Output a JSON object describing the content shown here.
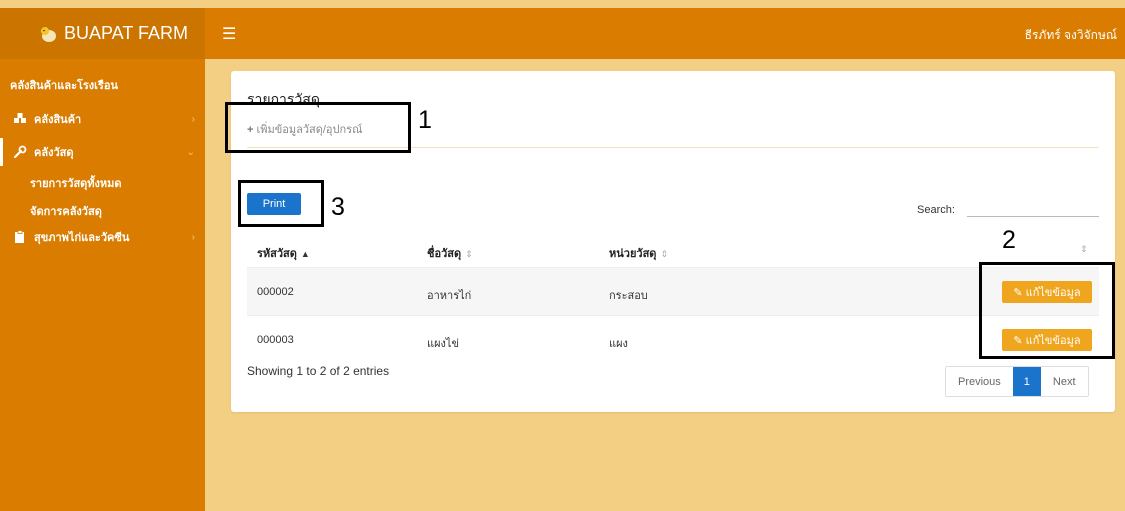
{
  "brand": {
    "name": "BUAPAT FARM",
    "logo_icon": "chick-egg-icon"
  },
  "topbar": {
    "menu_icon": "hamburger-icon",
    "username": "ธีรภัทร์ จงวิจักษณ์"
  },
  "sidebar": {
    "header": "คลังสินค้าและโรงเรือน",
    "items": [
      {
        "label": "คลังสินค้า",
        "icon": "cubes-icon"
      },
      {
        "label": "คลังวัสดุ",
        "icon": "wrench-icon"
      },
      {
        "label": "สุขภาพไก่และวัคซีน",
        "icon": "clipboard-icon"
      }
    ],
    "subitems": [
      {
        "label": "รายการวัสดุทั้งหมด"
      },
      {
        "label": "จัดการคลังวัสดุ"
      }
    ]
  },
  "main": {
    "title": "รายการวัสดุ",
    "add_link": "เพิ่มข้อมูลวัสดุ/อุปกรณ์",
    "print_label": "Print",
    "search_label": "Search:",
    "search_value": "",
    "columns": [
      "รหัสวัสดุ",
      "ชื่อวัสดุ",
      "หน่วยวัสดุ"
    ],
    "rows": [
      {
        "code": "000002",
        "name": "อาหารไก่",
        "unit": "กระสอบ",
        "action": "แก้ไขข้อมูล"
      },
      {
        "code": "000003",
        "name": "แผงไข่",
        "unit": "แผง",
        "action": "แก้ไขข้อมูล"
      }
    ],
    "info": "Showing 1 to 2 of 2 entries",
    "pagination": {
      "previous": "Previous",
      "current": "1",
      "next": "Next"
    }
  },
  "annotations": {
    "label_1": "1",
    "label_2": "2",
    "label_3": "3"
  },
  "colors": {
    "sidebar": "#d97c00",
    "background": "#f3cf84",
    "primary": "#1b74cc",
    "warning": "#f0a51e"
  }
}
